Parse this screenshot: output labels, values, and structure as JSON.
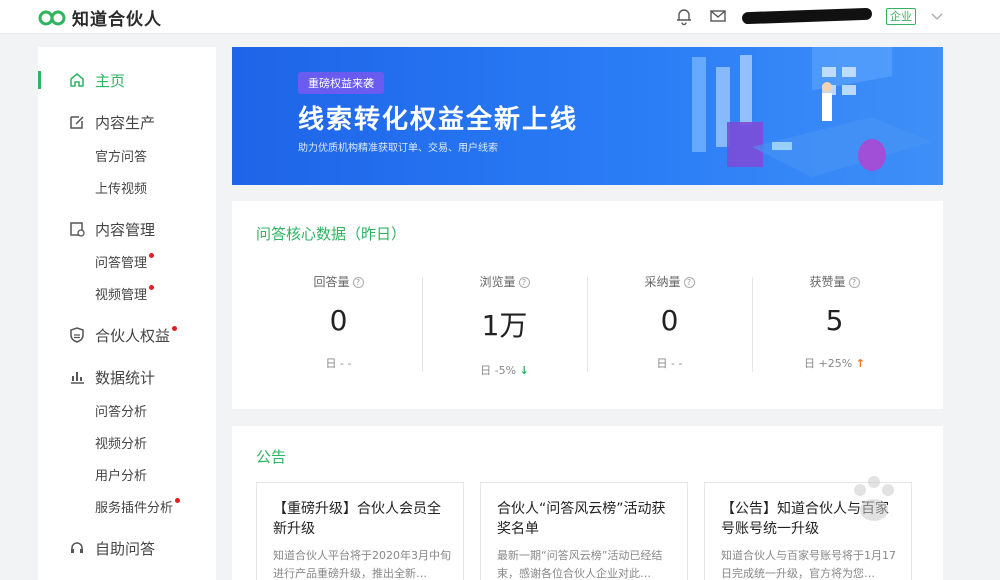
{
  "app": {
    "logo_text": "知道合伙人",
    "account_badge": "企业"
  },
  "sidebar": {
    "items": [
      {
        "label": "主页",
        "icon": "home-icon",
        "active": true
      },
      {
        "label": "内容生产",
        "icon": "edit-icon",
        "subs": [
          "官方问答",
          "上传视频"
        ]
      },
      {
        "label": "内容管理",
        "icon": "manage-icon",
        "subs": [
          "问答管理",
          "视频管理"
        ]
      },
      {
        "label": "合伙人权益",
        "icon": "shield-icon"
      },
      {
        "label": "数据统计",
        "icon": "bar-chart-icon",
        "subs": [
          "问答分析",
          "视频分析",
          "用户分析",
          "服务插件分析"
        ]
      },
      {
        "label": "自助问答",
        "icon": "headset-icon"
      }
    ]
  },
  "banner": {
    "tag": "重磅权益来袭",
    "title": "线索转化权益全新上线",
    "subtitle": "助力优质机构精准获取订单、交易、用户线索"
  },
  "stats": {
    "title": "问答核心数据（昨日）",
    "items": [
      {
        "label": "回答量",
        "value": "0",
        "change": "日 - -"
      },
      {
        "label": "浏览量",
        "value": "1万",
        "change": "日 -5%",
        "trend": "down"
      },
      {
        "label": "采纳量",
        "value": "0",
        "change": "日 - -"
      },
      {
        "label": "获赞量",
        "value": "5",
        "change": "日 +25%",
        "trend": "up"
      }
    ]
  },
  "notice": {
    "title": "公告",
    "items": [
      {
        "title": "【重磅升级】合伙人会员全新升级",
        "body": "知道合伙人平台将于2020年3月中旬进行产品重磅升级，推出全新…"
      },
      {
        "title": "合伙人“问答风云榜”活动获奖名单",
        "body": "最新一期“问答风云榜”活动已经结束，感谢各位合伙人企业对此…"
      },
      {
        "title": "【公告】知道合伙人与百家号账号统一升级",
        "body": "知道合伙人与百家号账号将于1月17日完成统一升级，官方将为您…"
      }
    ]
  },
  "colors": {
    "accent": "#2fb460",
    "banner": "#2a7cf5",
    "alert_dot": "#e02020"
  }
}
